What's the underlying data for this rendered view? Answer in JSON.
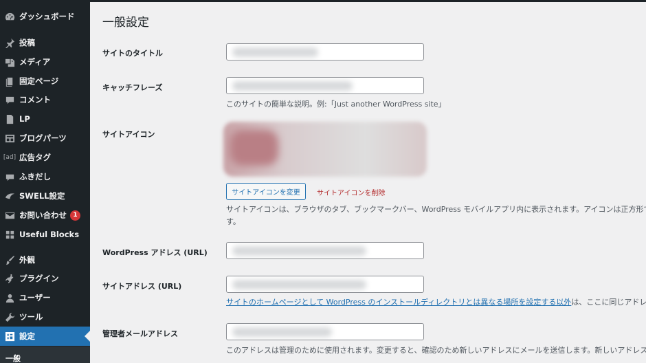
{
  "sidebar": {
    "items": [
      {
        "label": "ダッシュボード",
        "icon": "dashboard-icon"
      },
      {
        "label": "投稿",
        "icon": "pin-icon"
      },
      {
        "label": "メディア",
        "icon": "media-icon"
      },
      {
        "label": "固定ページ",
        "icon": "page-icon"
      },
      {
        "label": "コメント",
        "icon": "comment-icon"
      },
      {
        "label": "LP",
        "icon": "document-icon"
      },
      {
        "label": "ブログパーツ",
        "icon": "layout-icon"
      },
      {
        "label": "広告タグ",
        "icon": "ad-icon",
        "icon_text": "[ad]"
      },
      {
        "label": "ふきだし",
        "icon": "speech-bubble-icon"
      },
      {
        "label": "SWELL設定",
        "icon": "swell-icon"
      },
      {
        "label": "お問い合わせ",
        "icon": "mail-icon",
        "badge": "1"
      },
      {
        "label": "Useful Blocks",
        "icon": "blocks-icon"
      },
      {
        "label": "外観",
        "icon": "brush-icon"
      },
      {
        "label": "プラグイン",
        "icon": "plugin-icon"
      },
      {
        "label": "ユーザー",
        "icon": "user-icon"
      },
      {
        "label": "ツール",
        "icon": "wrench-icon"
      },
      {
        "label": "設定",
        "icon": "settings-icon",
        "active": true
      }
    ],
    "submenu_current": "一般"
  },
  "page": {
    "title": "一般設定",
    "site_title_label": "サイトのタイトル",
    "tagline_label": "キャッチフレーズ",
    "tagline_desc": "このサイトの簡単な説明。例:「Just another WordPress site」",
    "site_icon_label": "サイトアイコン",
    "change_icon_button": "サイトアイコンを変更",
    "delete_icon_link": "サイトアイコンを削除",
    "site_icon_desc_line1": "サイトアイコンは、ブラウザのタブ、ブックマークバー、WordPress モバイルアプリ内に表示されます。アイコンは正方形で、少",
    "site_icon_desc_line2": "す。",
    "wp_address_label": "WordPress アドレス (URL)",
    "site_address_label": "サイトアドレス (URL)",
    "site_address_link": "サイトのホームページとして WordPress のインストールディレクトリとは異なる場所を設定する以外",
    "site_address_desc_rest": "は、ここに同じアドレスを入",
    "admin_email_label": "管理者メールアドレス",
    "admin_email_desc": "このアドレスは管理のために使用されます。変更すると、確認のため新しいアドレスにメールを送信します。新しいアドレスは確"
  },
  "colors": {
    "sidebar_bg": "#1d2327",
    "active_bg": "#2271b1",
    "link": "#2271b1",
    "delete": "#b32d2e",
    "badge": "#d63638"
  }
}
